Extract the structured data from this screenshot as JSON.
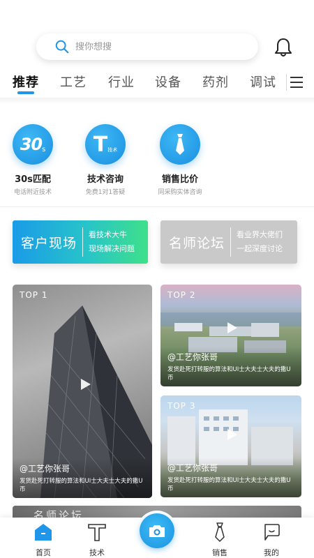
{
  "search": {
    "placeholder": "搜你想搜"
  },
  "tabs": [
    {
      "label": "推荐",
      "active": true
    },
    {
      "label": "工艺"
    },
    {
      "label": "行业"
    },
    {
      "label": "设备"
    },
    {
      "label": "药剂"
    },
    {
      "label": "调试"
    }
  ],
  "services": [
    {
      "icon": "30s-icon",
      "badge": "30",
      "badge_sub": "s",
      "title": "30s匹配",
      "subtitle": "电话附近技术"
    },
    {
      "icon": "tech-t-icon",
      "badge": "T",
      "badge_sub": "技术",
      "title": "技术咨询",
      "subtitle": "免费1对1答疑"
    },
    {
      "icon": "tie-icon",
      "title": "销售比价",
      "subtitle": "同采购实体咨询"
    }
  ],
  "banners": [
    {
      "title": "客户现场",
      "line1": "看技术大牛",
      "line2": "现场解决问题"
    },
    {
      "title": "名师论坛",
      "line1": "看业界大佬们",
      "line2": "一起深度讨论"
    }
  ],
  "videos": [
    {
      "rank": "TOP 1",
      "author": "@工艺你张哥",
      "desc": "发货赴死打转服的算法和UI士大夫士大夫的撒U币"
    },
    {
      "rank": "TOP 2",
      "author": "@工艺你张哥",
      "desc": "发货赴死打转服的算法和UI士大夫士大夫的撒U币"
    },
    {
      "rank": "TOP 3",
      "author": "@工艺你张哥",
      "desc": "发货赴死打转服的算法和UI士大夫士大夫的撒U币"
    }
  ],
  "strip": {
    "text": "名师论坛"
  },
  "nav": [
    {
      "label": "首页",
      "active": true
    },
    {
      "label": "技术"
    },
    {
      "label": "销售"
    },
    {
      "label": "我的"
    }
  ],
  "colors": {
    "accent": "#2196e8",
    "gradient_end": "#3ee08a",
    "muted": "#c9c9c9"
  }
}
